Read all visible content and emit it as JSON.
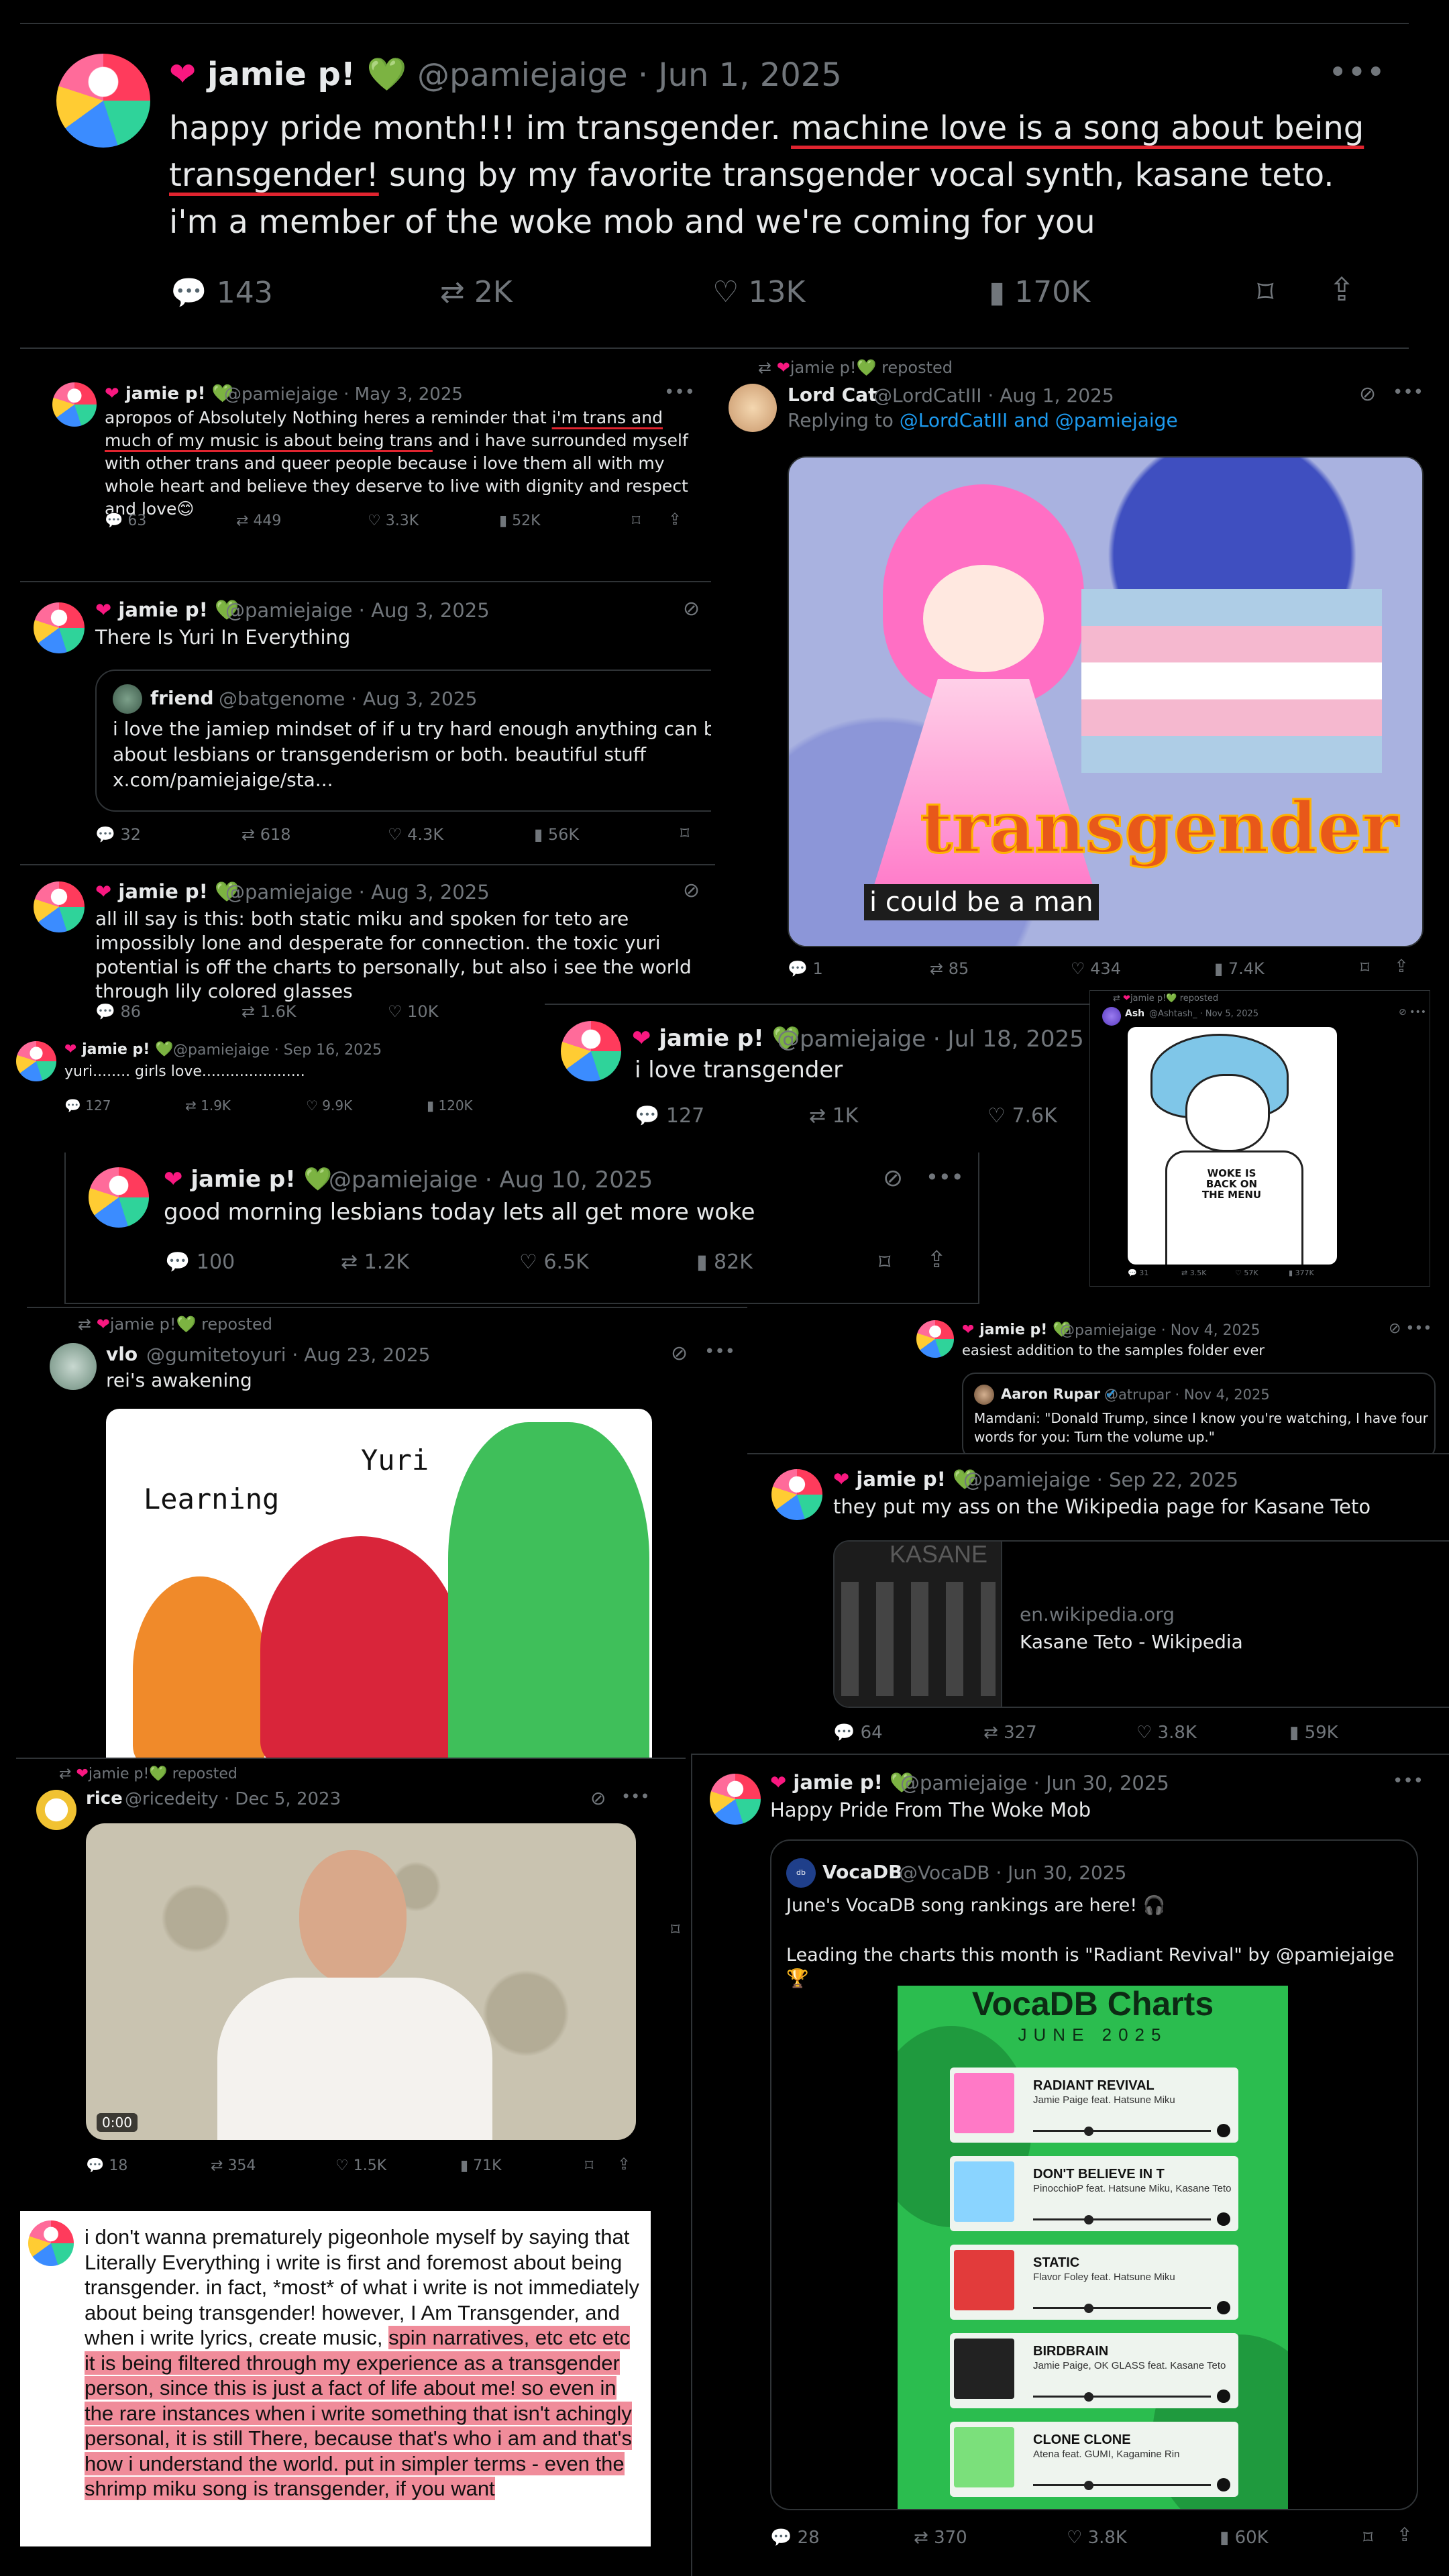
{
  "colors": {
    "bg": "#000000",
    "text": "#e7e9ea",
    "muted": "#71767b",
    "link": "#1d9bf0",
    "heart": "#f91880",
    "green": "#3bb54a",
    "highlight": "#f08c9a",
    "underline": "#e0242f"
  },
  "main": {
    "name": "jamie p!",
    "handle": "@pamiejaige",
    "date": "· Jun 1, 2025",
    "text_a": "happy pride month!!! im transgender. ",
    "text_u1": "machine love is a song about being",
    "text_u2": "transgender!",
    "text_b": " sung by my favorite transgender vocal synth, kasane teto. i'm a member of the woke mob and we're coming for you",
    "replies": "143",
    "reposts": "2K",
    "likes": "13K",
    "views": "170K"
  },
  "t1": {
    "name": "jamie p!",
    "handle": "@pamiejaige · May 3, 2025",
    "text_a": "apropos of Absolutely Nothing heres a reminder that ",
    "text_u": "i'm trans and much of my music is about being trans",
    "text_b": " and i have surrounded myself with other trans and queer people because i love them all with my whole heart and believe they deserve to live with dignity and respect and love😊",
    "replies": "63",
    "reposts": "449",
    "likes": "3.3K",
    "views": "52K"
  },
  "t2": {
    "reposted_by": "jamie p!",
    "reposted": "reposted",
    "name": "Lord Cat",
    "handle": "@LordCatIII · Aug 1, 2025",
    "replying": "Replying to",
    "replying_to": "@LordCatIII and @pamiejaige",
    "img_word": "transgender",
    "img_caption": "i could be a man",
    "replies": "1",
    "reposts": "85",
    "likes": "434",
    "views": "7.4K"
  },
  "t3": {
    "name": "jamie p!",
    "handle": "@pamiejaige · Aug 3, 2025",
    "text": "There Is Yuri In Everything",
    "q_name": "friend",
    "q_handle": "@batgenome · Aug 3, 2025",
    "q_text": "i love the jamiep mindset of if u try hard enough anything can be about lesbians or transgenderism or both. beautiful stuff x.com/pamiejaige/sta...",
    "replies": "32",
    "reposts": "618",
    "likes": "4.3K",
    "views": "56K"
  },
  "t4": {
    "name": "jamie p!",
    "handle": "@pamiejaige · Aug 3, 2025",
    "text": "all ill say is this: both static miku and spoken for teto are impossibly lone and desperate for connection. the toxic yuri potential is off the charts to personally, but also i see the world through lily colored glasses",
    "replies": "86",
    "reposts": "1.6K",
    "likes": "10K"
  },
  "t5": {
    "name": "jamie p!",
    "handle": "@pamiejaige · Sep 16, 2025",
    "text": "yuri........ girls love......................",
    "replies": "127",
    "reposts": "1.9K",
    "likes": "9.9K",
    "views": "120K"
  },
  "t6": {
    "name": "jamie p!",
    "handle": "@pamiejaige · Jul 18, 2025",
    "text": "i love transgender",
    "replies": "127",
    "reposts": "1K",
    "likes": "7.6K"
  },
  "t7": {
    "reposted_by": "jamie p!",
    "reposted": "reposted",
    "name": "Ash",
    "handle": "@Ashtash_ · Nov 5, 2025",
    "shirt": "WOKE IS BACK ON THE MENU",
    "replies": "31",
    "reposts": "3.5K",
    "likes": "57K",
    "views": "377K"
  },
  "t8": {
    "name": "jamie p!",
    "handle": "@pamiejaige · Aug 10, 2025",
    "text": "good morning lesbians today lets all get more woke",
    "replies": "100",
    "reposts": "1.2K",
    "likes": "6.5K",
    "views": "82K"
  },
  "t9": {
    "reposted_by": "jamie p!",
    "reposted": "reposted",
    "name": "vlo",
    "handle": "@gumitetoyuri · Aug 23, 2025",
    "text": "rei's awakening",
    "label_learning": "Learning",
    "label_yuri": "Yuri"
  },
  "t10": {
    "name": "jamie p!",
    "handle": "@pamiejaige · Nov 4, 2025",
    "text": "easiest addition to the samples folder ever",
    "q_name": "Aaron Rupar",
    "q_handle": "@atrupar · Nov 4, 2025",
    "q_text": "Mamdani: \"Donald Trump, since I know you're watching, I have four words for you: Turn the volume up.\""
  },
  "t11": {
    "name": "jamie p!",
    "handle": "@pamiejaige · Sep 22, 2025",
    "text": "they put my ass on the Wikipedia page for Kasane Teto",
    "card_thumb": "KASANE",
    "card_domain": "en.wikipedia.org",
    "card_title": "Kasane Teto - Wikipedia",
    "replies": "64",
    "reposts": "327",
    "likes": "3.8K",
    "views": "59K"
  },
  "t12": {
    "reposted_by": "jamie p!",
    "reposted": "reposted",
    "name": "rice",
    "handle": "@ricedeity · Dec 5, 2023",
    "time": "0:00",
    "replies": "18",
    "reposts": "354",
    "likes": "1.5K",
    "views": "71K"
  },
  "t13": {
    "name": "jamie p!",
    "handle": "@pamiejaige · Jun 30, 2025",
    "text": "Happy Pride From The Woke Mob",
    "q_name": "VocaDB",
    "q_handle": "@VocaDB · Jun 30, 2025",
    "q_text1": "June's VocaDB song rankings are here! 🎧",
    "q_text2": "Leading the charts this month is \"Radiant Revival\" by @pamiejaige 🏆",
    "chart_title": "VocaDB Charts",
    "chart_sub": "JUNE 2025",
    "rankings": [
      {
        "title": "RADIANT REVIVAL",
        "artist": "Jamie Paige feat. Hatsune Miku"
      },
      {
        "title": "DON'T BELIEVE IN T",
        "artist": "PinocchioP feat. Hatsune Miku, Kasane Teto"
      },
      {
        "title": "STATIC",
        "artist": "Flavor Foley feat. Hatsune Miku"
      },
      {
        "title": "BIRDBRAIN",
        "artist": "Jamie Paige, OK GLASS feat. Kasane Teto"
      },
      {
        "title": "CLONE CLONE",
        "artist": "Atena feat. GUMI, Kagamine Rin"
      }
    ],
    "replies": "28",
    "reposts": "370",
    "likes": "3.8K",
    "views": "60K"
  },
  "t14": {
    "text_a": "i don't wanna prematurely pigeonhole myself by saying that Literally Everything i write is first and foremost about being transgender. in fact, *most* of what i write is not immediately about being transgender! however, I Am Transgender, and when i write lyrics, create music, ",
    "text_h": "spin narratives, etc etc etc it is being filtered through my experience as a transgender person, since this is just a fact of life about me! so even in the rare instances when i write something that isn't achingly personal, it is still There, because that's who i am and that's how i understand the world. put in simpler terms - even the shrimp miku song is transgender, if you want"
  },
  "icons": {
    "reply": "reply-icon",
    "repost": "repost-icon",
    "like": "heart-icon",
    "views": "views-icon",
    "bookmark": "bookmark-icon",
    "share": "share-icon",
    "more": "more-icon",
    "grok": "grok-icon"
  }
}
